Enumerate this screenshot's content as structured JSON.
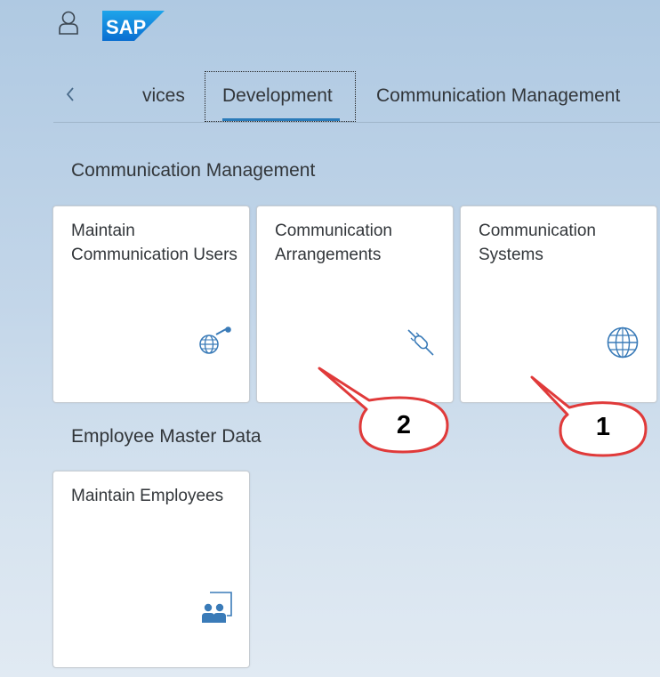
{
  "header": {
    "user_icon": "user-icon",
    "logo_text": "SAP"
  },
  "tabs": {
    "back_icon": "chevron-left-icon",
    "items": [
      {
        "label": "vices",
        "selected": false
      },
      {
        "label": "Development",
        "selected": true
      },
      {
        "label": "Communication Management",
        "selected": false
      }
    ]
  },
  "sections": [
    {
      "title": "Communication Management",
      "tiles": [
        {
          "title": "Maintain Communication Users",
          "icon": "globe-key-icon"
        },
        {
          "title": "Communication Arrangements",
          "icon": "connector-icon"
        },
        {
          "title": "Communication Systems",
          "icon": "globe-icon"
        }
      ]
    },
    {
      "title": "Employee Master Data",
      "tiles": [
        {
          "title": "Maintain Employees",
          "icon": "employees-icon"
        }
      ]
    }
  ],
  "callouts": [
    {
      "number": "2",
      "target": "Communication Arrangements"
    },
    {
      "number": "1",
      "target": "Communication Systems"
    }
  ],
  "colors": {
    "accent": "#2b7bb9",
    "icon": "#3a7bb8",
    "callout_border": "#e03a3a"
  }
}
